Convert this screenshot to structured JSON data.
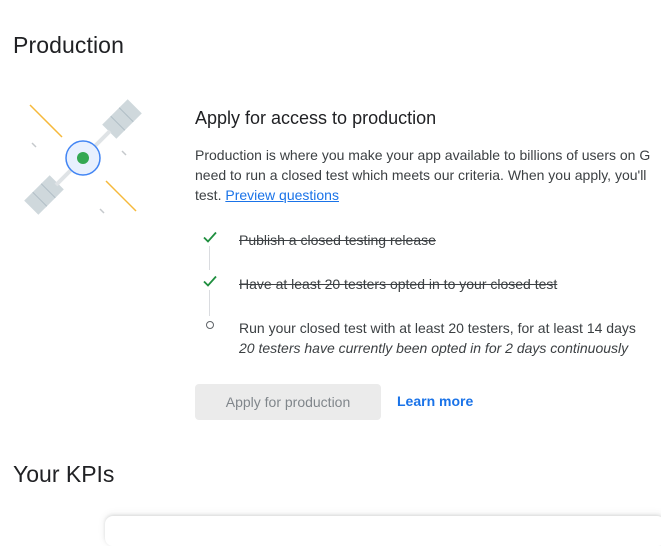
{
  "page": {
    "title": "Production"
  },
  "access": {
    "title": "Apply for access to production",
    "description_lines": [
      "Production is where you make your app available to billions of users on G",
      "need to run a closed test which meets our criteria. When you apply, you'll",
      "test."
    ],
    "preview_link": "Preview questions",
    "steps": [
      {
        "label": "Publish a closed testing release",
        "status": "done"
      },
      {
        "label": "Have at least 20 testers opted in to your closed test",
        "status": "done"
      },
      {
        "label": "Run your closed test with at least 20 testers, for at least 14 days",
        "detail": "20 testers have currently been opted in for 2 days continuously",
        "status": "pending"
      }
    ],
    "apply_button": "Apply for production",
    "learn_more": "Learn more"
  },
  "kpis": {
    "title": "Your KPIs"
  },
  "colors": {
    "accent": "#1a73e8",
    "check": "#1e8e3e",
    "satellite_core": "#34a853"
  }
}
